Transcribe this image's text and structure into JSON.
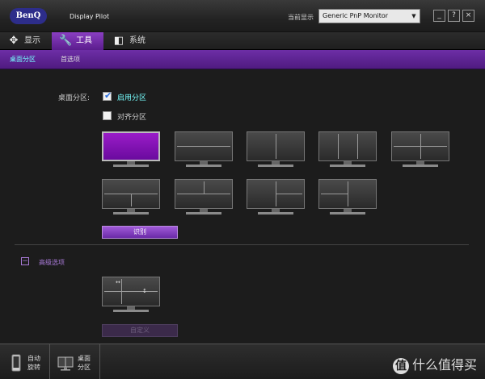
{
  "window": {
    "brand": "BenQ",
    "title": "Display Pilot",
    "monitor_label": "当前显示",
    "monitor_value": "Generic PnP Monitor",
    "minimize": "_",
    "help": "?",
    "close": "×"
  },
  "tabs": [
    {
      "label": "显示",
      "icon": "display-settings-icon"
    },
    {
      "label": "工具",
      "icon": "wrench-icon"
    },
    {
      "label": "系统",
      "icon": "system-icon"
    }
  ],
  "subtabs": [
    {
      "label": "桌面分区"
    },
    {
      "label": "首选项"
    }
  ],
  "partition": {
    "label": "桌面分区:",
    "enable_label": "启用分区",
    "enable_checked": true,
    "align_label": "对齐分区",
    "align_checked": false,
    "identify_button": "识别"
  },
  "advanced": {
    "label": "高级选项",
    "collapse_symbol": "−",
    "customize_button": "自定义"
  },
  "bottom": {
    "auto_rotate": "自动\n旋转",
    "desktop_partition": "桌面\n分区"
  },
  "watermark": {
    "badge": "值",
    "text": "什么值得买"
  },
  "colors": {
    "accent": "#7b2fb8",
    "active_text": "#77ffff"
  }
}
